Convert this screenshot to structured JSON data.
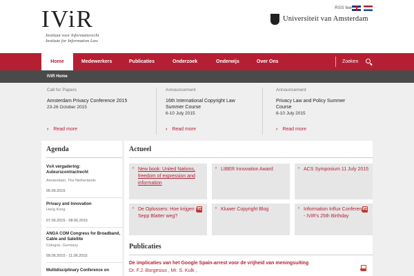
{
  "header": {
    "logo": {
      "word": "IViR",
      "line1": "Instituut voor Informatierecht",
      "line2": "Institute for Information Law"
    },
    "rss": "RSS feed",
    "university": "Universiteit van Amsterdam"
  },
  "nav": {
    "items": [
      "Home",
      "Medewerkers",
      "Publicaties",
      "Onderzoek",
      "Onderwijs",
      "Over Ons"
    ],
    "search": "Zoeken"
  },
  "breadcrumb": "IViR Home",
  "announcements": [
    {
      "kind": "Call for Papers",
      "title": "Amsterdam Privacy Conference 2015",
      "date": "23-26 October 2015",
      "more": "Read more"
    },
    {
      "kind": "Announcement",
      "title": "16th International Copyright Law Summer Course",
      "date": "6-10 July 2015",
      "more": "Read more"
    },
    {
      "kind": "Announcement",
      "title": "Privacy Law and Policy Summer Course",
      "date": "6-10 July 2015",
      "more": "Read more"
    }
  ],
  "agenda": {
    "heading": "Agenda",
    "items": [
      {
        "title": "VvA vergadering: Auteurscontractrecht",
        "location": "Amsterdam, The Netherlands",
        "date": "05.06.2015"
      },
      {
        "title": "Privacy and Innovation",
        "location": "Hong Kong",
        "date": "07.06.2015 - 08.06.2015"
      },
      {
        "title": "ANGA COM Congress for Broadband, Cable and Satellite",
        "location": "Cologne, Germany",
        "date": "09.06.2015 - 11.06.2015"
      },
      {
        "title": "Multidisciplinary Conference on",
        "location": "",
        "date": ""
      }
    ]
  },
  "actueel": {
    "heading": "Actueel",
    "cards": [
      {
        "text": "New book: United Nations, freedom of expression and information"
      },
      {
        "text": "LIBER Innovation Award"
      },
      {
        "text": "ACS Symposium 11 July 2015"
      },
      {
        "text": "De Oplossers: Hoe krijgen we Sepp Blatter weg?"
      },
      {
        "text": "Kluwer Copyright Blog"
      },
      {
        "text": "Information Influx Conference - IViR's 25th Birthday"
      }
    ]
  },
  "publicaties": {
    "heading": "Publicaties",
    "title": "De implicaties van het Google Spain-arrest voor de vrijheid van meningsuiting",
    "authors": "Dr. F.J. Borgesius , Mr. S. Kulk ,"
  }
}
